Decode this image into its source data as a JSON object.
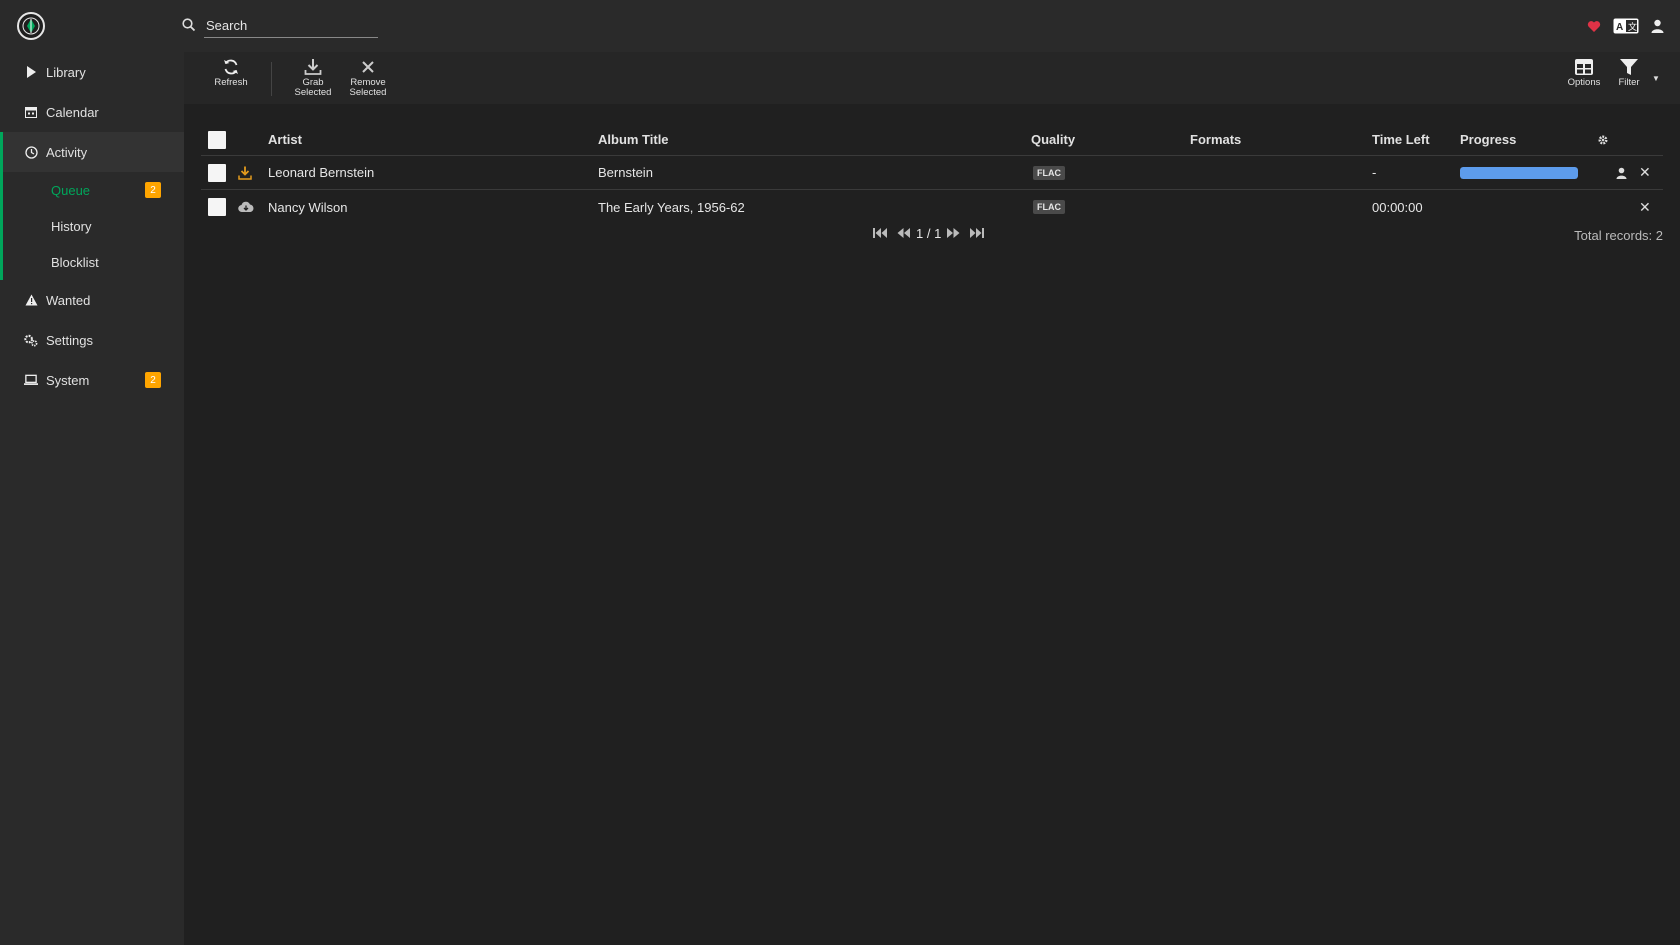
{
  "header": {
    "search_placeholder": "Search"
  },
  "sidebar": {
    "items": [
      {
        "label": "Library",
        "icon": "play-icon"
      },
      {
        "label": "Calendar",
        "icon": "calendar-icon"
      },
      {
        "label": "Activity",
        "icon": "clock-icon"
      },
      {
        "label": "Wanted",
        "icon": "warning-icon"
      },
      {
        "label": "Settings",
        "icon": "gears-icon"
      },
      {
        "label": "System",
        "icon": "laptop-icon",
        "badge": "2"
      }
    ],
    "activity_sub": [
      {
        "label": "Queue",
        "badge": "2"
      },
      {
        "label": "History"
      },
      {
        "label": "Blocklist"
      }
    ]
  },
  "toolbar": {
    "refresh": "Refresh",
    "grab_selected": "Grab Selected",
    "remove_selected": "Remove Selected",
    "options": "Options",
    "filter": "Filter"
  },
  "table": {
    "columns": [
      "Artist",
      "Album Title",
      "Quality",
      "Formats",
      "Time Left",
      "Progress"
    ],
    "rows": [
      {
        "status_icon": "download-icon",
        "artist": "Leonard Bernstein",
        "album": "Bernstein",
        "quality": "FLAC",
        "formats": "",
        "time_left": "-",
        "progress": 1.0
      },
      {
        "status_icon": "cloud-icon",
        "artist": "Nancy Wilson",
        "album": "The Early Years, 1956-62",
        "quality": "FLAC",
        "formats": "",
        "time_left": "00:00:00",
        "progress": null
      }
    ]
  },
  "pager": {
    "page": "1 / 1",
    "total": "Total records: 2"
  },
  "colors": {
    "accent": "#00a65b",
    "badge": "#ffa500",
    "progress": "#5d9cec",
    "heart": "#e03246"
  }
}
